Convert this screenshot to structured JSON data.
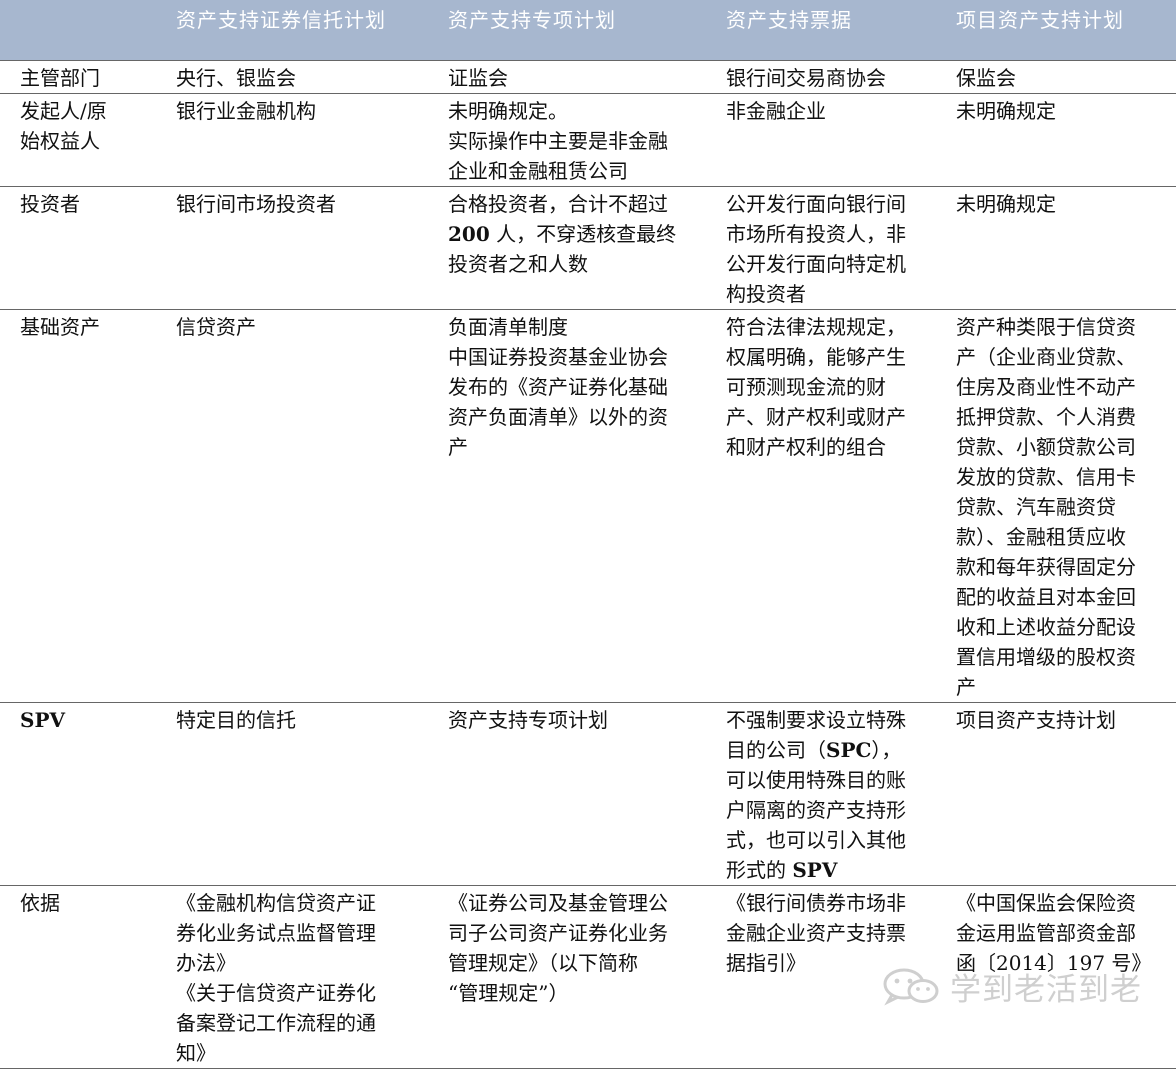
{
  "table": {
    "headers": [
      "",
      "资产支持证券信托计划",
      "资产支持专项计划",
      "资产支持票据",
      "项目资产支持计划"
    ],
    "rows": [
      {
        "label": [
          "主管部门"
        ],
        "cells": [
          [
            "央行、银监会"
          ],
          [
            "证监会"
          ],
          [
            "银行间交易商协会"
          ],
          [
            "保监会"
          ]
        ]
      },
      {
        "label": [
          "发起人/原",
          "始权益人"
        ],
        "cells": [
          [
            "银行业金融机构"
          ],
          [
            "未明确规定。",
            "实际操作中主要是非金融",
            "企业和金融租赁公司"
          ],
          [
            "非金融企业"
          ],
          [
            "未明确规定"
          ]
        ]
      },
      {
        "label": [
          "投资者"
        ],
        "cells": [
          [
            "银行间市场投资者"
          ],
          [
            "合格投资者，合计不超过",
            "200 人，不穿透核查最终",
            "投资者之和人数"
          ],
          [
            "公开发行面向银行间",
            "市场所有投资人，非",
            "公开发行面向特定机",
            "构投资者"
          ],
          [
            "未明确规定"
          ]
        ]
      },
      {
        "label": [
          "基础资产"
        ],
        "cells": [
          [
            "信贷资产"
          ],
          [
            "负面清单制度",
            "中国证券投资基金业协会",
            "发布的《资产证券化基础",
            "资产负面清单》以外的资",
            "产"
          ],
          [
            "符合法律法规规定，",
            "权属明确，能够产生",
            "可预测现金流的财",
            "产、财产权利或财产",
            "和财产权利的组合"
          ],
          [
            "资产种类限于信贷资",
            "产（企业商业贷款、",
            "住房及商业性不动产",
            "抵押贷款、个人消费",
            "贷款、小额贷款公司",
            "发放的贷款、信用卡",
            "贷款、汽车融资贷",
            "款）、金融租赁应收",
            "款和每年获得固定分",
            "配的收益且对本金回",
            "收和上述收益分配设",
            "置信用增级的股权资",
            "产"
          ]
        ]
      },
      {
        "label": [
          "SPV"
        ],
        "cells": [
          [
            "特定目的信托"
          ],
          [
            "资产支持专项计划"
          ],
          [
            "不强制要求设立特殊",
            "目的公司（SPC），",
            "可以使用特殊目的账",
            "户隔离的资产支持形",
            "式，也可以引入其他",
            "形式的 SPV"
          ],
          [
            "项目资产支持计划"
          ]
        ]
      },
      {
        "label": [
          "依据"
        ],
        "cells": [
          [
            "《金融机构信贷资产证",
            "券化业务试点监督管理",
            "办法》",
            "《关于信贷资产证券化",
            "备案登记工作流程的通",
            "知》"
          ],
          [
            "《证券公司及基金管理公",
            "司子公司资产证券化业务",
            "管理规定》（以下简称",
            "“管理规定”）"
          ],
          [
            "《银行间债券市场非",
            "金融企业资产支持票",
            "据指引》"
          ],
          [
            "《中国保监会保险资",
            "金运用监管部资金部",
            "函〔2014〕197 号》"
          ]
        ]
      }
    ]
  },
  "watermark": {
    "text": "学到老活到老",
    "icon": "wechat-icon"
  }
}
